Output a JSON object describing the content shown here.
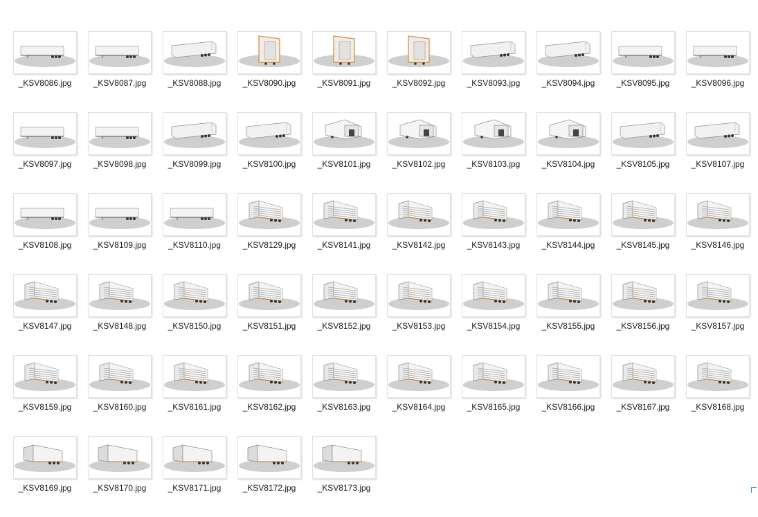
{
  "files": [
    {
      "name": "_KSV8086.jpg",
      "kind": "side"
    },
    {
      "name": "_KSV8087.jpg",
      "kind": "side"
    },
    {
      "name": "_KSV8088.jpg",
      "kind": "angle"
    },
    {
      "name": "_KSV8090.jpg",
      "kind": "front-orange"
    },
    {
      "name": "_KSV8091.jpg",
      "kind": "front-orange"
    },
    {
      "name": "_KSV8092.jpg",
      "kind": "front-orange"
    },
    {
      "name": "_KSV8093.jpg",
      "kind": "angle"
    },
    {
      "name": "_KSV8094.jpg",
      "kind": "angle"
    },
    {
      "name": "_KSV8095.jpg",
      "kind": "side"
    },
    {
      "name": "_KSV8096.jpg",
      "kind": "side"
    },
    {
      "name": "_KSV8097.jpg",
      "kind": "side"
    },
    {
      "name": "_KSV8098.jpg",
      "kind": "side"
    },
    {
      "name": "_KSV8099.jpg",
      "kind": "angle"
    },
    {
      "name": "_KSV8100.jpg",
      "kind": "angle"
    },
    {
      "name": "_KSV8101.jpg",
      "kind": "rear"
    },
    {
      "name": "_KSV8102.jpg",
      "kind": "rear"
    },
    {
      "name": "_KSV8103.jpg",
      "kind": "rear"
    },
    {
      "name": "_KSV8104.jpg",
      "kind": "rear"
    },
    {
      "name": "_KSV8105.jpg",
      "kind": "angle"
    },
    {
      "name": "_KSV8107.jpg",
      "kind": "angle"
    },
    {
      "name": "_KSV8108.jpg",
      "kind": "side"
    },
    {
      "name": "_KSV8109.jpg",
      "kind": "side"
    },
    {
      "name": "_KSV8110.jpg",
      "kind": "side"
    },
    {
      "name": "_KSV8129.jpg",
      "kind": "open"
    },
    {
      "name": "_KSV8141.jpg",
      "kind": "open"
    },
    {
      "name": "_KSV8142.jpg",
      "kind": "open"
    },
    {
      "name": "_KSV8143.jpg",
      "kind": "open"
    },
    {
      "name": "_KSV8144.jpg",
      "kind": "open"
    },
    {
      "name": "_KSV8145.jpg",
      "kind": "open"
    },
    {
      "name": "_KSV8146.jpg",
      "kind": "open"
    },
    {
      "name": "_KSV8147.jpg",
      "kind": "open"
    },
    {
      "name": "_KSV8148.jpg",
      "kind": "open"
    },
    {
      "name": "_KSV8150.jpg",
      "kind": "open"
    },
    {
      "name": "_KSV8151.jpg",
      "kind": "open"
    },
    {
      "name": "_KSV8152.jpg",
      "kind": "open"
    },
    {
      "name": "_KSV8153.jpg",
      "kind": "open"
    },
    {
      "name": "_KSV8154.jpg",
      "kind": "open"
    },
    {
      "name": "_KSV8155.jpg",
      "kind": "open"
    },
    {
      "name": "_KSV8156.jpg",
      "kind": "open"
    },
    {
      "name": "_KSV8157.jpg",
      "kind": "open"
    },
    {
      "name": "_KSV8159.jpg",
      "kind": "open"
    },
    {
      "name": "_KSV8160.jpg",
      "kind": "open"
    },
    {
      "name": "_KSV8161.jpg",
      "kind": "open"
    },
    {
      "name": "_KSV8162.jpg",
      "kind": "open"
    },
    {
      "name": "_KSV8163.jpg",
      "kind": "open"
    },
    {
      "name": "_KSV8164.jpg",
      "kind": "open"
    },
    {
      "name": "_KSV8165.jpg",
      "kind": "open"
    },
    {
      "name": "_KSV8166.jpg",
      "kind": "open"
    },
    {
      "name": "_KSV8167.jpg",
      "kind": "open"
    },
    {
      "name": "_KSV8168.jpg",
      "kind": "open"
    },
    {
      "name": "_KSV8169.jpg",
      "kind": "closed"
    },
    {
      "name": "_KSV8170.jpg",
      "kind": "closed"
    },
    {
      "name": "_KSV8171.jpg",
      "kind": "closed"
    },
    {
      "name": "_KSV8172.jpg",
      "kind": "closed"
    },
    {
      "name": "_KSV8173.jpg",
      "kind": "closed"
    }
  ]
}
